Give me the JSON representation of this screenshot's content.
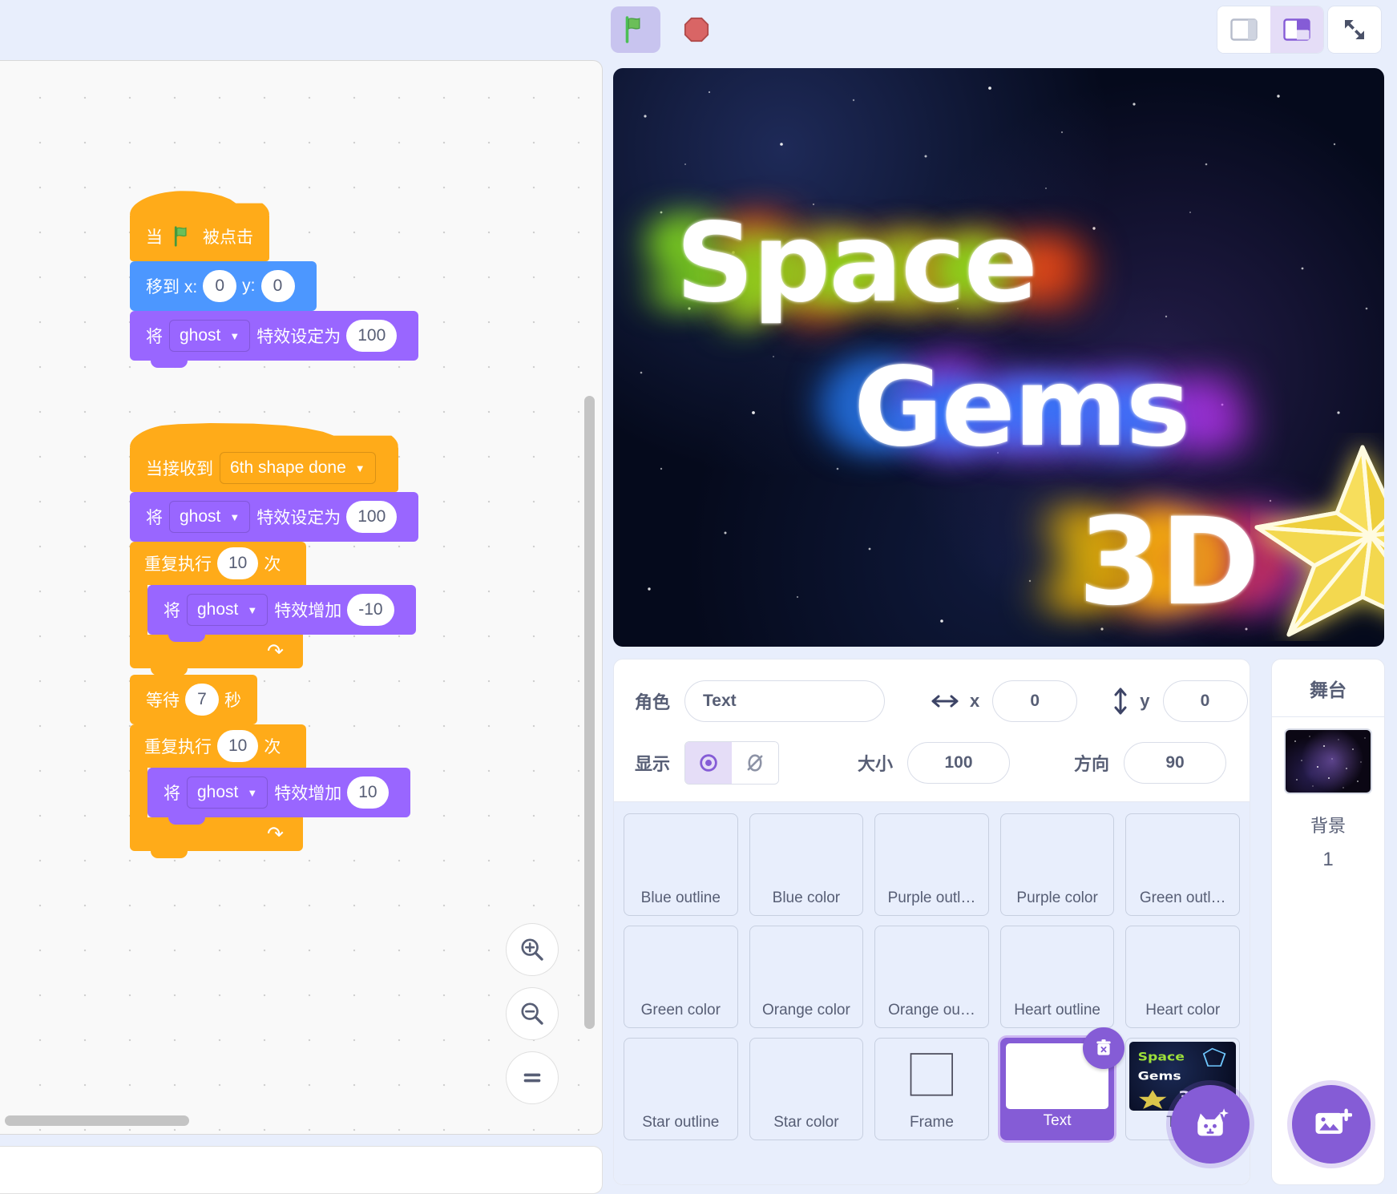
{
  "toolbar": {
    "green_flag_label": "green-flag",
    "stop_label": "stop",
    "layout_small_label": "small-stage-layout",
    "layout_large_label": "large-stage-layout",
    "fullscreen_label": "fullscreen"
  },
  "scripts": [
    {
      "id": "script1",
      "blocks": [
        {
          "type": "hat",
          "category": "events",
          "text_before": "当",
          "icon": "green-flag-icon",
          "text_after": "被点击"
        },
        {
          "type": "stack",
          "category": "motion",
          "label": "移到 x:",
          "x": "0",
          "y_label": "y:",
          "y": "0"
        },
        {
          "type": "stack",
          "category": "looks",
          "prefix": "将",
          "dropdown": "ghost",
          "suffix": "特效设定为",
          "value": "100"
        }
      ]
    },
    {
      "id": "script2",
      "blocks": [
        {
          "type": "hat",
          "category": "events",
          "prefix": "当接收到",
          "dropdown": "6th shape done"
        },
        {
          "type": "stack",
          "category": "looks",
          "prefix": "将",
          "dropdown": "ghost",
          "suffix": "特效设定为",
          "value": "100"
        },
        {
          "type": "c-block",
          "category": "control",
          "prefix": "重复执行",
          "count": "10",
          "suffix": "次",
          "inner": {
            "category": "looks",
            "prefix": "将",
            "dropdown": "ghost",
            "suffix": "特效增加",
            "value": "-10"
          }
        },
        {
          "type": "stack",
          "category": "control",
          "prefix": "等待",
          "value": "7",
          "suffix": "秒"
        },
        {
          "type": "c-block",
          "category": "control",
          "prefix": "重复执行",
          "count": "10",
          "suffix": "次",
          "inner": {
            "category": "looks",
            "prefix": "将",
            "dropdown": "ghost",
            "suffix": "特效增加",
            "value": "10"
          }
        }
      ]
    }
  ],
  "code_controls": {
    "zoom_in": "zoom-in",
    "zoom_out": "zoom-out",
    "zoom_reset": "zoom-reset"
  },
  "stage": {
    "title_line1": "Space",
    "title_line2": "Gems",
    "title_line3": "3D",
    "gem_icon": "diamond-gem",
    "star_icon": "star-gem"
  },
  "sprite_info": {
    "name_label": "角色",
    "name_value": "Text",
    "x_label": "x",
    "x_value": "0",
    "y_label": "y",
    "y_value": "0",
    "show_label": "显示",
    "size_label": "大小",
    "size_value": "100",
    "direction_label": "方向",
    "direction_value": "90"
  },
  "sprites": [
    {
      "label": "Blue outline",
      "selected": false,
      "thumb": "none"
    },
    {
      "label": "Blue color",
      "selected": false,
      "thumb": "none"
    },
    {
      "label": "Purple outl…",
      "selected": false,
      "thumb": "none"
    },
    {
      "label": "Purple color",
      "selected": false,
      "thumb": "none"
    },
    {
      "label": "Green outl…",
      "selected": false,
      "thumb": "none"
    },
    {
      "label": "Green color",
      "selected": false,
      "thumb": "none"
    },
    {
      "label": "Orange color",
      "selected": false,
      "thumb": "none"
    },
    {
      "label": "Orange ou…",
      "selected": false,
      "thumb": "none"
    },
    {
      "label": "Heart outline",
      "selected": false,
      "thumb": "none"
    },
    {
      "label": "Heart color",
      "selected": false,
      "thumb": "none"
    },
    {
      "label": "Star outline",
      "selected": false,
      "thumb": "none"
    },
    {
      "label": "Star color",
      "selected": false,
      "thumb": "none"
    },
    {
      "label": "Frame",
      "selected": false,
      "thumb": "frame"
    },
    {
      "label": "Text",
      "selected": true,
      "thumb": "white"
    },
    {
      "label": "Th…",
      "selected": false,
      "thumb": "space"
    }
  ],
  "add_sprite_button": "add-sprite",
  "stage_panel": {
    "title": "舞台",
    "backdrop_label": "背景",
    "backdrop_count": "1",
    "add_backdrop_button": "add-backdrop"
  }
}
